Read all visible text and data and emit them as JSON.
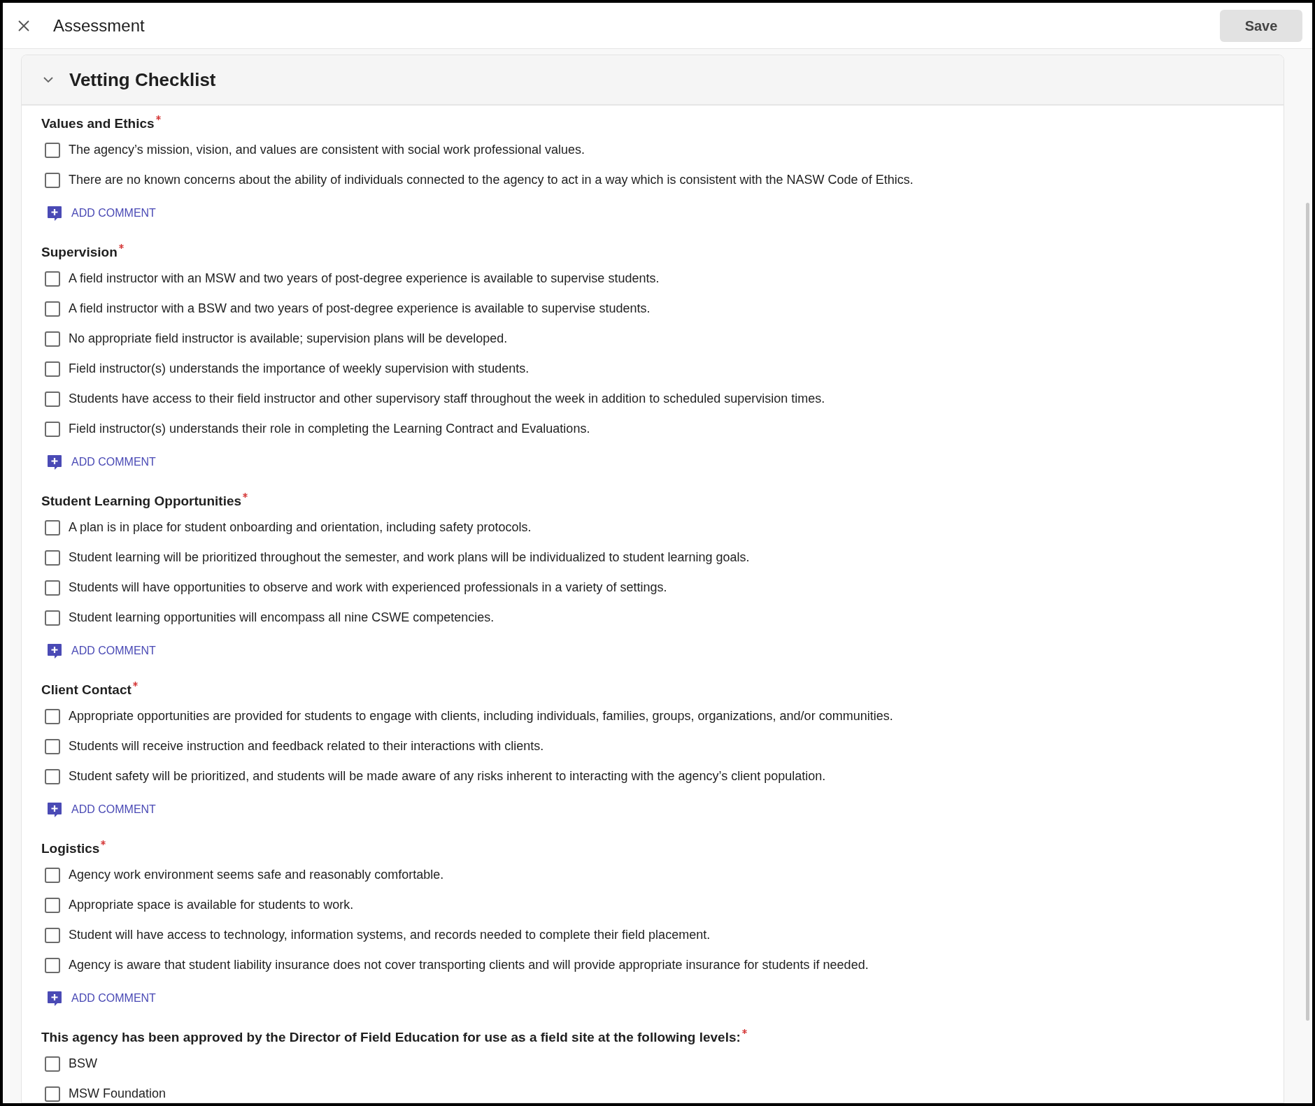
{
  "header": {
    "title": "Assessment",
    "save": "Save"
  },
  "panel": {
    "title": "Vetting Checklist",
    "expanded": true
  },
  "sections": [
    {
      "title": "Values and Ethics",
      "required": true,
      "items": [
        {
          "label": "The agency’s mission, vision, and values are consistent with social work professional values.",
          "checked": false
        },
        {
          "label": "There are no known concerns about the ability of individuals connected to the agency to act in a way which is consistent with the NASW Code of Ethics.",
          "checked": false
        }
      ],
      "add_comment": "ADD COMMENT"
    },
    {
      "title": "Supervision",
      "required": true,
      "items": [
        {
          "label": "A field instructor with an MSW and two years of post-degree experience is available to supervise students.",
          "checked": false
        },
        {
          "label": "A field instructor with a BSW and two years of post-degree experience is available to supervise students.",
          "checked": false
        },
        {
          "label": "No appropriate field instructor is available; supervision plans will be developed.",
          "checked": false
        },
        {
          "label": "Field instructor(s) understands the importance of weekly supervision with students.",
          "checked": false
        },
        {
          "label": "Students have access to their field instructor and other supervisory staff throughout the week in addition to scheduled supervision times.",
          "checked": false
        },
        {
          "label": "Field instructor(s) understands their role in completing the Learning Contract and Evaluations.",
          "checked": false
        }
      ],
      "add_comment": "ADD COMMENT"
    },
    {
      "title": "Student Learning Opportunities",
      "required": true,
      "items": [
        {
          "label": "A plan is in place for student onboarding and orientation, including safety protocols.",
          "checked": false
        },
        {
          "label": "Student learning will be prioritized throughout the semester, and work plans will be individualized to student learning goals.",
          "checked": false
        },
        {
          "label": "Students will have opportunities to observe and work with experienced professionals in a variety of settings.",
          "checked": false
        },
        {
          "label": "Student learning opportunities will encompass all nine CSWE competencies.",
          "checked": false
        }
      ],
      "add_comment": "ADD COMMENT"
    },
    {
      "title": "Client Contact",
      "required": true,
      "items": [
        {
          "label": "Appropriate opportunities are provided for students to engage with clients, including individuals, families, groups, organizations, and/or communities.",
          "checked": false
        },
        {
          "label": "Students will receive instruction and feedback related to their interactions with clients.",
          "checked": false
        },
        {
          "label": "Student safety will be prioritized, and students will be made aware of any risks inherent to interacting with the agency’s client population.",
          "checked": false
        }
      ],
      "add_comment": "ADD COMMENT"
    },
    {
      "title": "Logistics",
      "required": true,
      "items": [
        {
          "label": "Agency work environment seems safe and reasonably comfortable.",
          "checked": false
        },
        {
          "label": "Appropriate space is available for students to work.",
          "checked": false
        },
        {
          "label": "Student will have access to technology, information systems, and records needed to complete their field placement.",
          "checked": false
        },
        {
          "label": "Agency is aware that student liability insurance does not cover transporting clients and will provide appropriate insurance for students if needed.",
          "checked": false
        }
      ],
      "add_comment": "ADD COMMENT"
    },
    {
      "title": "This agency has been approved by the Director of Field Education for use as a field site at the following levels:",
      "required": true,
      "items": [
        {
          "label": "BSW",
          "checked": false
        },
        {
          "label": "MSW Foundation",
          "checked": false
        }
      ]
    }
  ]
}
